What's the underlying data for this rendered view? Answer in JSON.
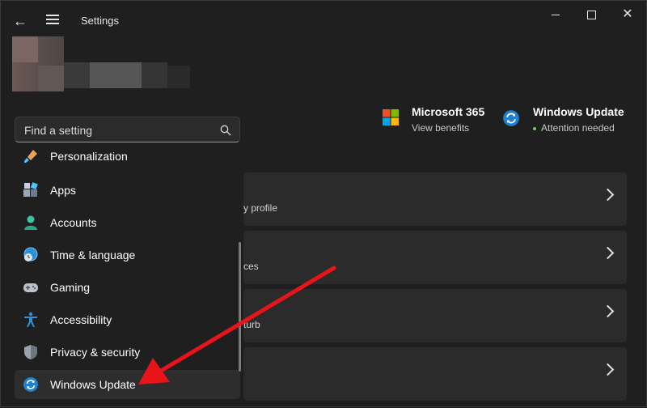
{
  "window": {
    "title": "Settings",
    "controls": [
      "minimize",
      "maximize",
      "close"
    ]
  },
  "search": {
    "placeholder": "Find a setting"
  },
  "sidebar": {
    "items": [
      {
        "label": "Personalization",
        "icon": "brush-icon"
      },
      {
        "label": "Apps",
        "icon": "apps-icon"
      },
      {
        "label": "Accounts",
        "icon": "person-icon"
      },
      {
        "label": "Time & language",
        "icon": "globe-clock-icon"
      },
      {
        "label": "Gaming",
        "icon": "gamepad-icon"
      },
      {
        "label": "Accessibility",
        "icon": "accessibility-icon"
      },
      {
        "label": "Privacy & security",
        "icon": "shield-icon"
      },
      {
        "label": "Windows Update",
        "icon": "update-icon",
        "active": true
      }
    ]
  },
  "header": {
    "microsoft365": {
      "title": "Microsoft 365",
      "subtitle": "View benefits"
    },
    "windows_update": {
      "title": "Windows Update",
      "subtitle": "Attention needed"
    }
  },
  "cards": [
    {
      "text": "y profile"
    },
    {
      "text": "ces"
    },
    {
      "text": "turb"
    },
    {
      "text": ""
    }
  ],
  "colors": {
    "accent": "#4cc2ff",
    "annotation_arrow": "#e8141a",
    "status_dot": "#6ccb5f"
  }
}
